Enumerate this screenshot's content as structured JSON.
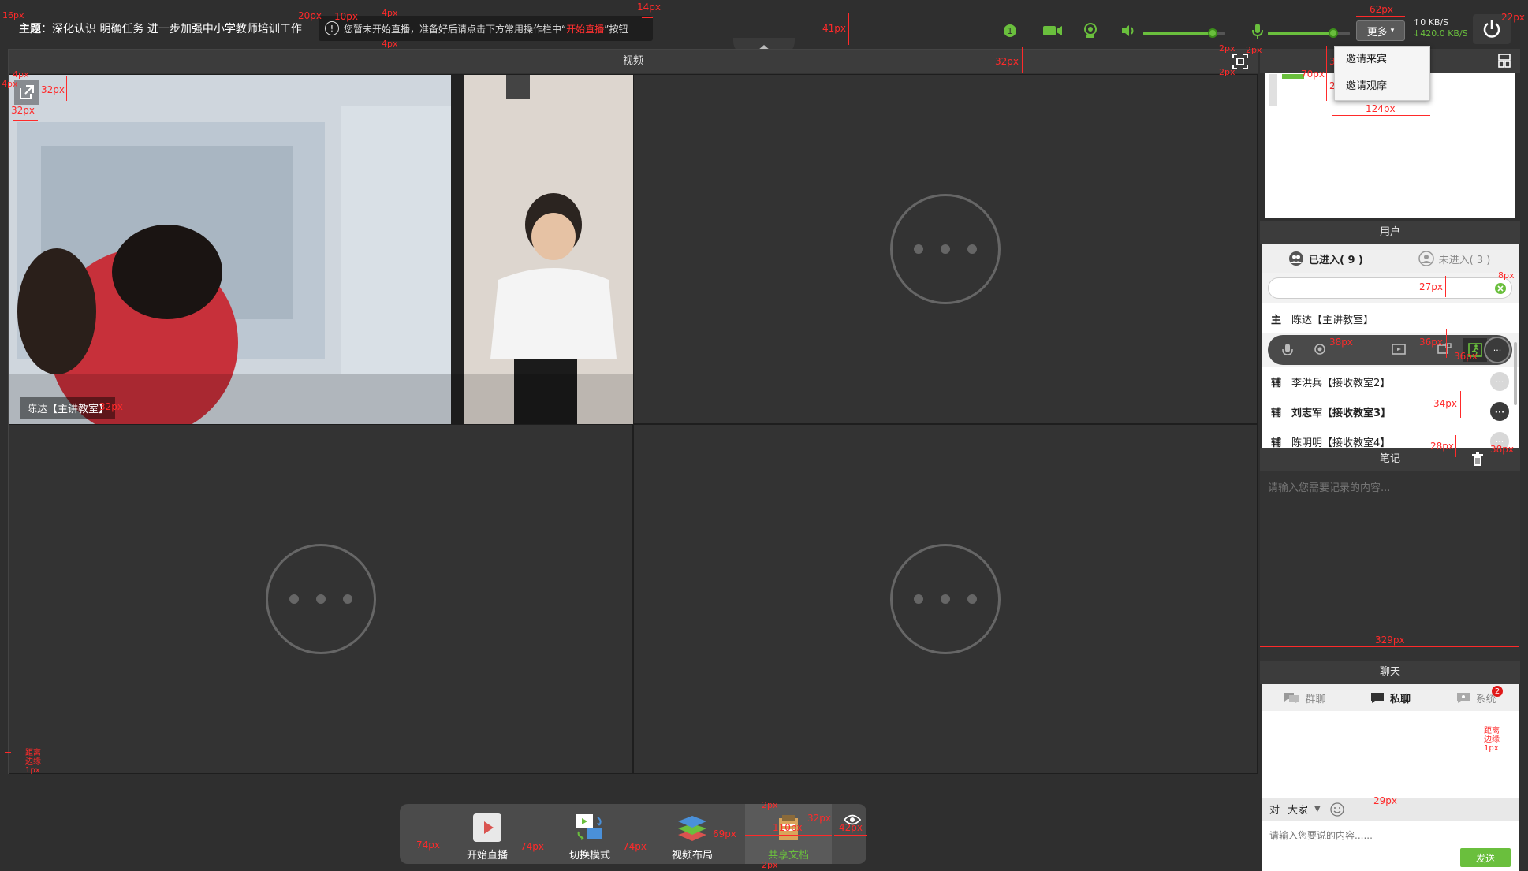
{
  "topbar": {
    "topic_label": "主题",
    "topic_sep": "：",
    "topic_text": "深化认识 明确任务 进一步加强中小学教师培训工作",
    "notice_icon": "!",
    "notice_before": "您暂未开始直播，准备好后请点击下方常用操作栏中“",
    "notice_highlight": "开始直播",
    "notice_after": "”按钮",
    "more_label": "更多",
    "upload_rate": "0 KB/S",
    "download_rate": "420.0 KB/S",
    "speaker_volume": 0.85,
    "mic_volume": 0.8
  },
  "more_menu": {
    "items": [
      "邀请来宾",
      "邀请观摩"
    ]
  },
  "video_panel": {
    "title": "视频",
    "main_camera_label": "陈达【主讲教室】"
  },
  "whiteboard": {
    "title_hidden": ""
  },
  "users": {
    "title": "用户",
    "tab_joined": "已进入( 9 )",
    "tab_not_joined": "未进入( 3 )",
    "search_value": "",
    "host": {
      "role": "主",
      "name": "陈达【主讲教室】"
    },
    "list": [
      {
        "role": "辅",
        "name": "李洪兵【接收教室2】"
      },
      {
        "role": "辅",
        "name": "刘志军【接收教室3】"
      },
      {
        "role": "辅",
        "name": "陈明明【接收教室4】"
      }
    ]
  },
  "notes": {
    "title": "笔记",
    "placeholder": "请输入您需要记录的内容..."
  },
  "chat": {
    "title": "聊天",
    "tab_group": "群聊",
    "tab_private": "私聊",
    "tab_system": "系统",
    "system_badge": "2",
    "to_label": "对",
    "to_target": "大家",
    "input_placeholder": "请输入您要说的内容......",
    "send_label": "发送"
  },
  "toolbar": {
    "start_live": "开始直播",
    "switch_mode": "切换模式",
    "video_layout": "视频布局",
    "share_doc": "共享文档"
  },
  "annotations": {
    "a1": "16px",
    "a2": "20px",
    "a3": "10px",
    "a4": "4px",
    "a5": "4px",
    "a6": "14px",
    "a7": "41px",
    "a8": "62px",
    "a9": "22px",
    "a10": "2px",
    "a11": "2px",
    "a12": "2px",
    "a13": "32px",
    "a14": "34px",
    "a15": "122px",
    "a16": "70px",
    "a17": "20px",
    "a18": "124px",
    "a19": "4px",
    "a20": "4px",
    "a21": "32px",
    "a22": "32px",
    "a23": "32px",
    "a24": "27px",
    "a25": "8px",
    "a26": "38px",
    "a27": "36px",
    "a28": "36px",
    "a29": "34px",
    "a30": "28px",
    "a31": "38px",
    "a32": "329px",
    "a33": "29px",
    "a34": "距离边缘1px",
    "a35": "距离边缘1px",
    "a36": "74px",
    "a37": "74px",
    "a38": "74px",
    "a39": "69px",
    "a40": "2px",
    "a41": "110px",
    "a42": "32px",
    "a43": "42px",
    "a44": "2px"
  }
}
